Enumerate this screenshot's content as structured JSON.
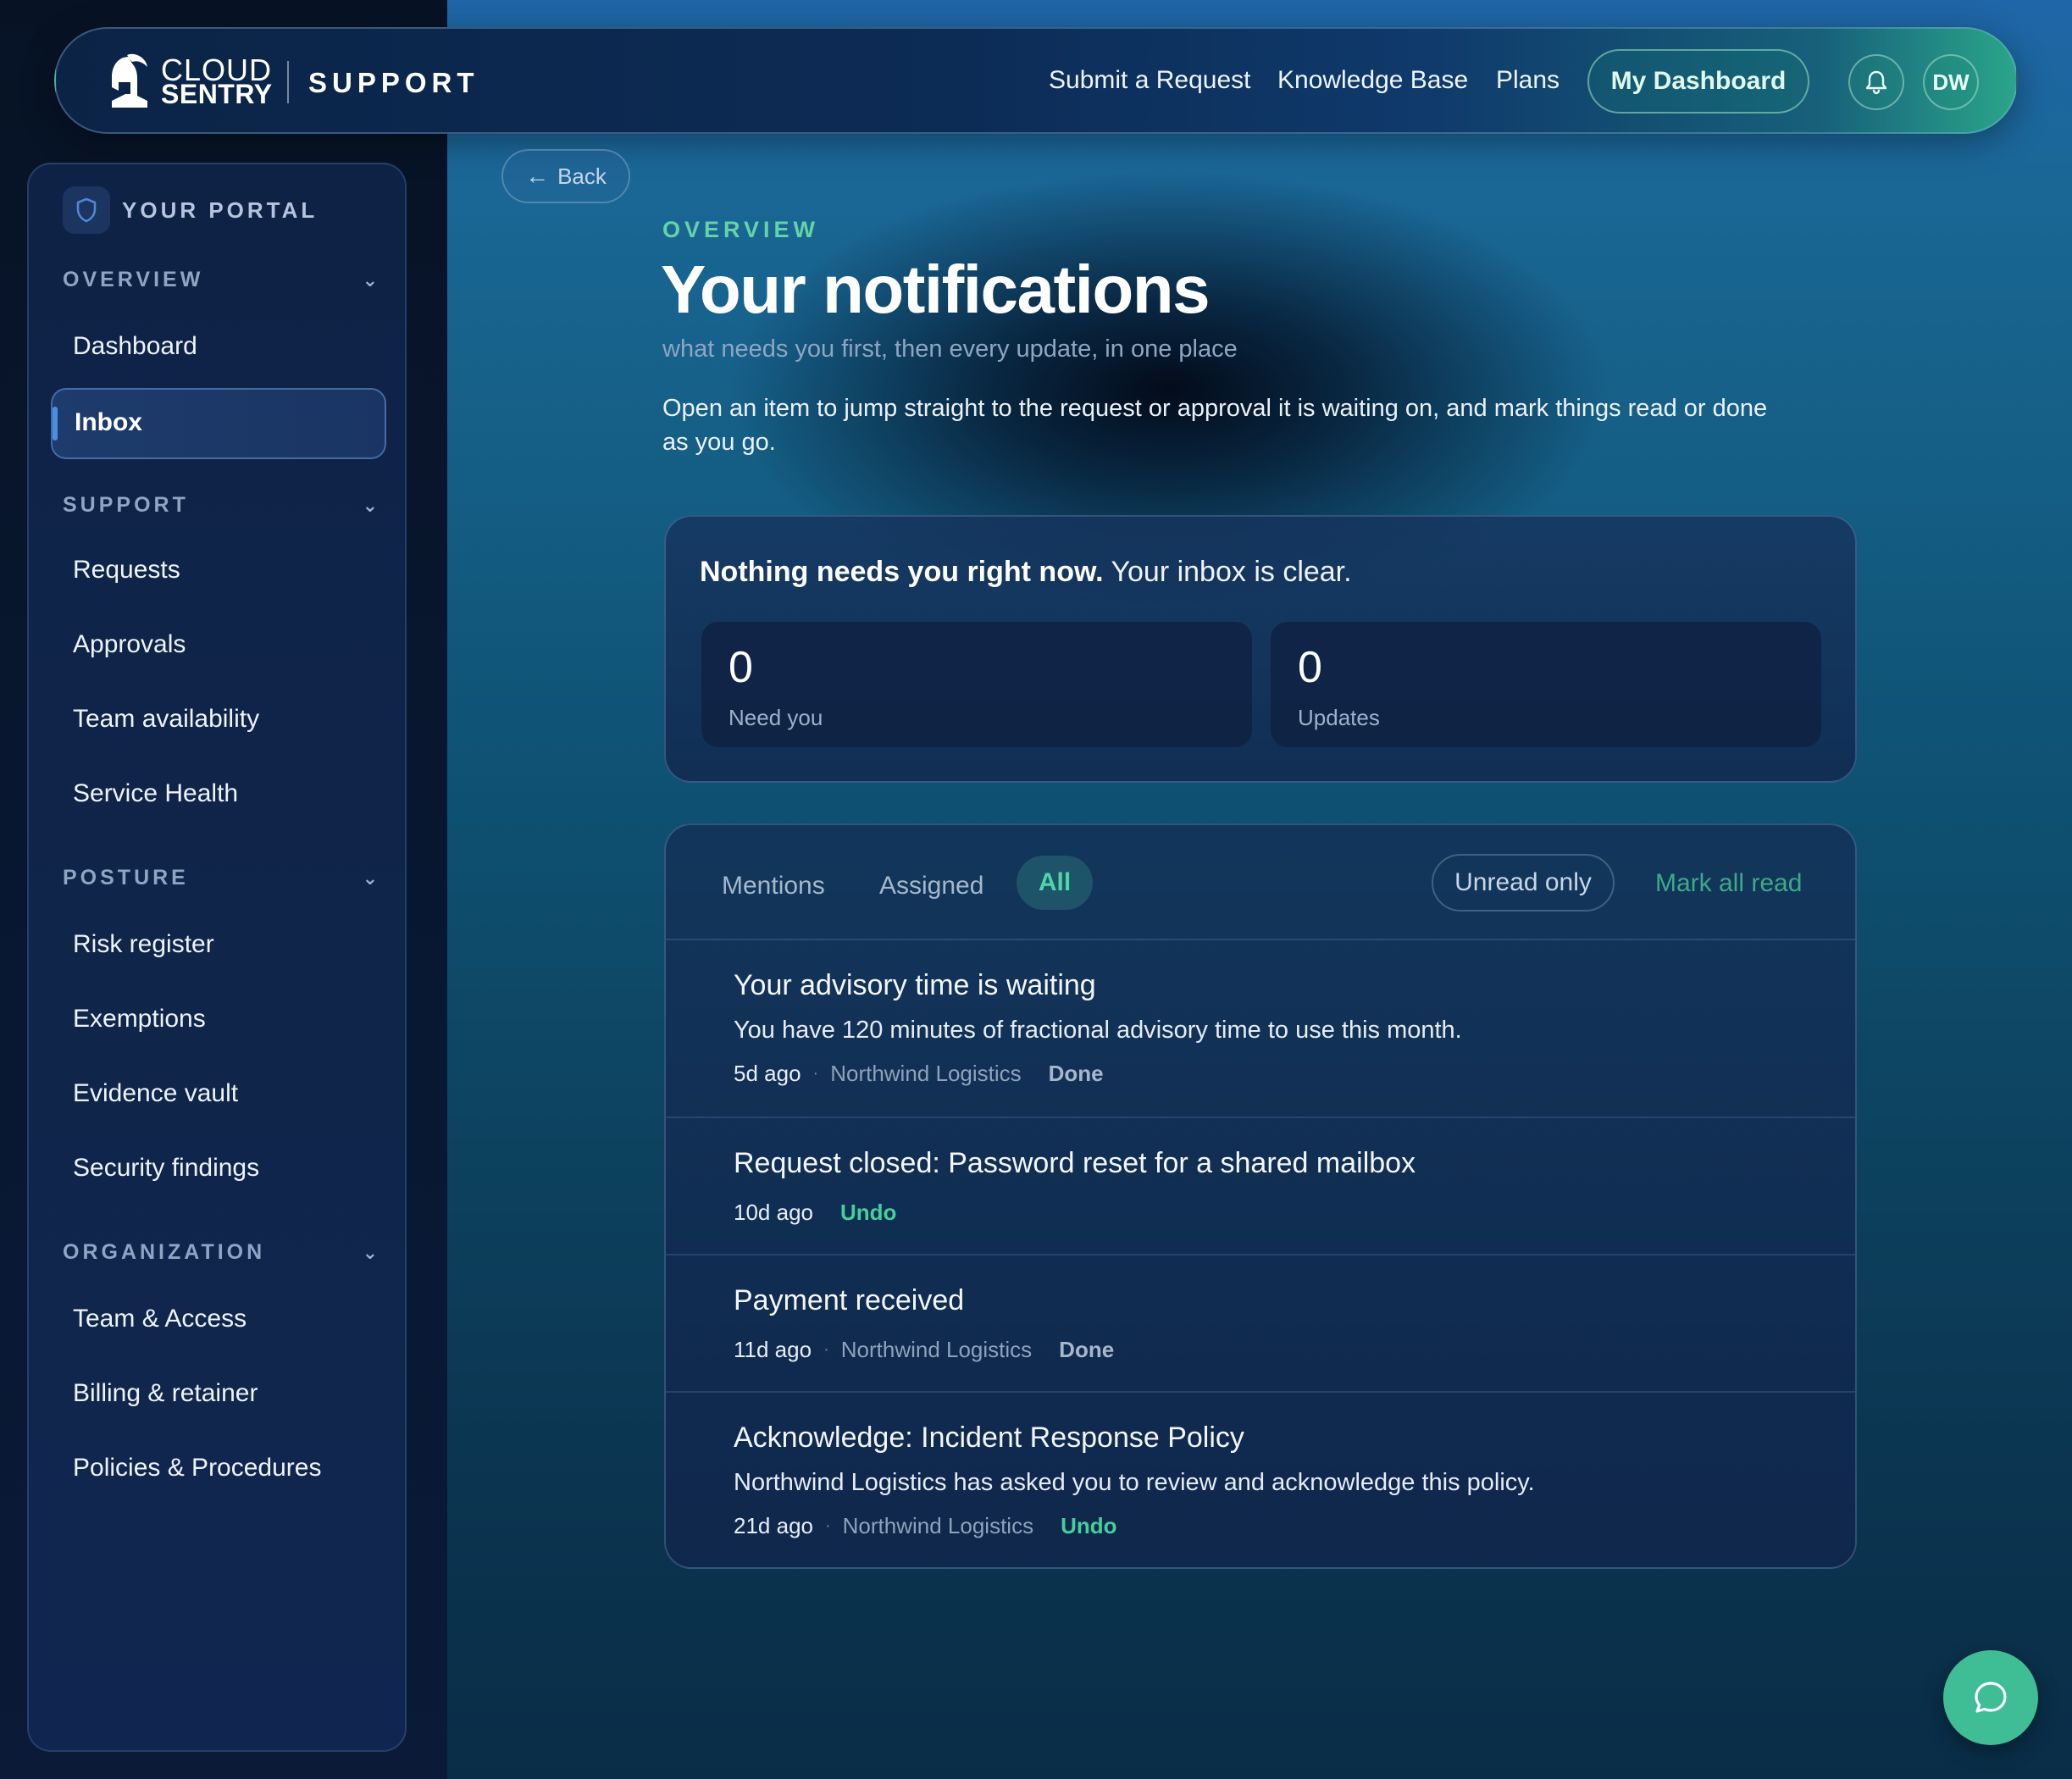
{
  "header": {
    "brand_line1": "CLOUD",
    "brand_line2": "SENTRY",
    "section": "SUPPORT",
    "nav": [
      "Submit a Request",
      "Knowledge Base",
      "Plans"
    ],
    "dashboard_button": "My Dashboard",
    "bell_icon": "bell-icon",
    "avatar_initials": "DW"
  },
  "sidebar": {
    "portal_label": "YOUR PORTAL",
    "portal_icon": "shield-icon",
    "sections": [
      {
        "label": "OVERVIEW",
        "items": [
          "Dashboard",
          "Inbox"
        ]
      },
      {
        "label": "SUPPORT",
        "items": [
          "Requests",
          "Approvals",
          "Team availability",
          "Service Health"
        ]
      },
      {
        "label": "POSTURE",
        "items": [
          "Risk register",
          "Exemptions",
          "Evidence vault",
          "Security findings"
        ]
      },
      {
        "label": "ORGANIZATION",
        "items": [
          "Team & Access",
          "Billing & retainer",
          "Policies & Procedures"
        ]
      }
    ],
    "active_item": "Inbox"
  },
  "main": {
    "back_label": "Back",
    "eyebrow": "OVERVIEW",
    "title": "Your notifications",
    "subtitle": "what needs you first, then every update, in one place",
    "intro": "Open an item to jump straight to the request or approval it is waiting on, and mark things read or done as you go.",
    "summary": {
      "bold": "Nothing needs you right now.",
      "rest": " Your inbox is clear.",
      "stats": [
        {
          "value": "0",
          "label": "Need you"
        },
        {
          "value": "0",
          "label": "Updates"
        }
      ]
    },
    "filters": {
      "tabs": [
        "Mentions",
        "Assigned",
        "All"
      ],
      "active_tab": "All",
      "unread_only": "Unread only",
      "mark_all_read": "Mark all read"
    },
    "notifications": [
      {
        "title": "Your advisory time is waiting",
        "body": "You have 120 minutes of fractional advisory time to use this month.",
        "age": "5d ago",
        "org": "Northwind Logistics",
        "action": "Done"
      },
      {
        "title": "Request closed: Password reset for a shared mailbox",
        "body": "",
        "age": "10d ago",
        "org": "",
        "action": "Undo"
      },
      {
        "title": "Payment received",
        "body": "",
        "age": "11d ago",
        "org": "Northwind Logistics",
        "action": "Done"
      },
      {
        "title": "Acknowledge: Incident Response Policy",
        "body": "Northwind Logistics has asked you to review and acknowledge this policy.",
        "age": "21d ago",
        "org": "Northwind Logistics",
        "action": "Undo"
      }
    ],
    "separator": "·"
  },
  "chat_icon": "chat-bubble-icon",
  "colors": {
    "accent_green": "#45cf9c",
    "nav_active_bar": "#4a90e2",
    "fab": "#3fbd95"
  }
}
